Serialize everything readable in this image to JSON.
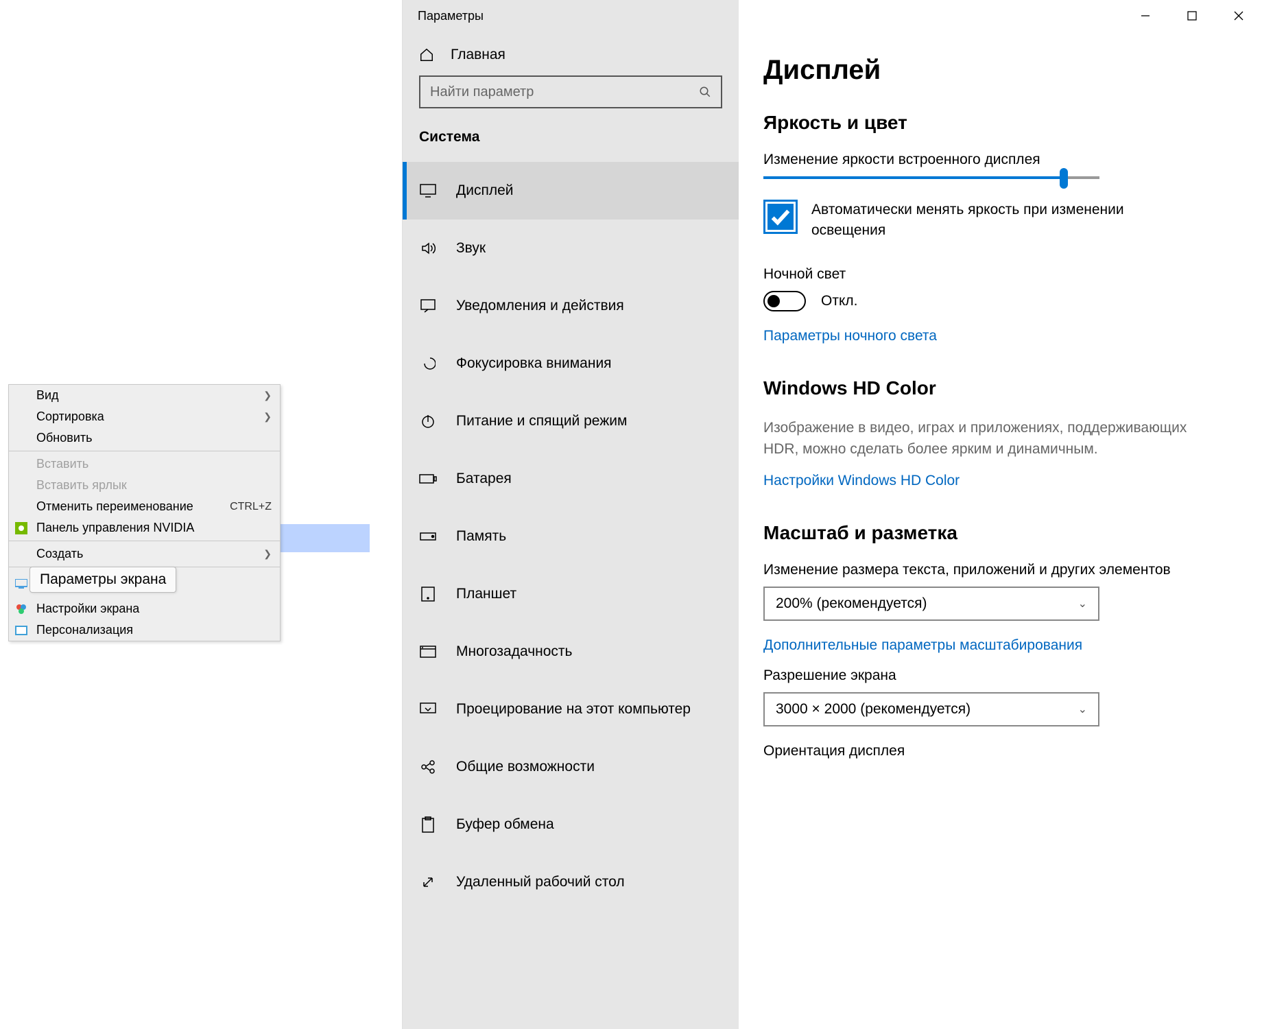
{
  "context_menu": {
    "items": [
      {
        "label": "Вид",
        "has_submenu": true
      },
      {
        "label": "Сортировка",
        "has_submenu": true
      },
      {
        "label": "Обновить"
      }
    ],
    "items2": [
      {
        "label": "Вставить",
        "disabled": true
      },
      {
        "label": "Вставить ярлык",
        "disabled": true
      },
      {
        "label": "Отменить переименование",
        "shortcut": "CTRL+Z"
      },
      {
        "label": "Панель управления NVIDIA",
        "icon": "nvidia"
      }
    ],
    "items3": [
      {
        "label": "Создать",
        "has_submenu": true
      }
    ],
    "items4": [
      {
        "label": "Параметры экрана",
        "icon": "display-blue",
        "highlighted": true
      },
      {
        "label": "Настройки экрана",
        "icon": "settings-color"
      },
      {
        "label": "Персонализация",
        "icon": "personalize"
      }
    ]
  },
  "settings": {
    "window_title": "Параметры",
    "home": "Главная",
    "search_placeholder": "Найти параметр",
    "category": "Система",
    "nav": [
      {
        "label": "Дисплей",
        "icon": "display",
        "active": true
      },
      {
        "label": "Звук",
        "icon": "sound"
      },
      {
        "label": "Уведомления и действия",
        "icon": "notifications"
      },
      {
        "label": "Фокусировка внимания",
        "icon": "focus"
      },
      {
        "label": "Питание и спящий режим",
        "icon": "power"
      },
      {
        "label": "Батарея",
        "icon": "battery"
      },
      {
        "label": "Память",
        "icon": "storage"
      },
      {
        "label": "Планшет",
        "icon": "tablet"
      },
      {
        "label": "Многозадачность",
        "icon": "multitask"
      },
      {
        "label": "Проецирование на этот компьютер",
        "icon": "project"
      },
      {
        "label": "Общие возможности",
        "icon": "shared"
      },
      {
        "label": "Буфер обмена",
        "icon": "clipboard"
      },
      {
        "label": "Удаленный рабочий стол",
        "icon": "remote"
      }
    ]
  },
  "page": {
    "title": "Дисплей",
    "brightness": {
      "heading": "Яркость и цвет",
      "slider_label": "Изменение яркости встроенного дисплея",
      "slider_value": 90,
      "auto_brightness_checked": true,
      "auto_brightness_label": "Автоматически менять яркость при изменении освещения",
      "night_light_label": "Ночной свет",
      "night_light_state": "Откл.",
      "night_light_toggle": false,
      "night_light_link": "Параметры ночного света"
    },
    "hdcolor": {
      "heading": "Windows HD Color",
      "desc": "Изображение в видео, играх и приложениях, поддерживающих HDR, можно сделать более ярким и динамичным.",
      "link": "Настройки Windows HD Color"
    },
    "scale": {
      "heading": "Масштаб и разметка",
      "scale_label": "Изменение размера текста, приложений и других элементов",
      "scale_value": "200% (рекомендуется)",
      "advanced_link": "Дополнительные параметры масштабирования",
      "resolution_label": "Разрешение экрана",
      "resolution_value": "3000 × 2000 (рекомендуется)",
      "orientation_label": "Ориентация дисплея"
    }
  }
}
